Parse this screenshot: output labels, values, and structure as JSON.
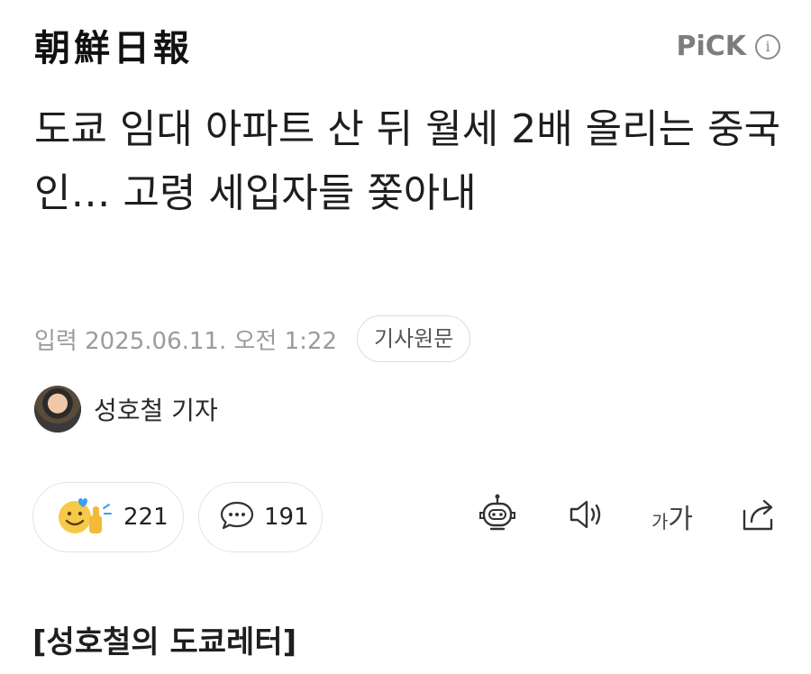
{
  "header": {
    "logo_text": "朝鮮日報",
    "pick_label": "PiCK",
    "info_glyph": "i"
  },
  "article": {
    "title": "도쿄 임대 아파트 산 뒤 월세 2배 올리는 중국인… 고령 세입자들 쫓아내",
    "date_label": "입력 2025.06.11. 오전 1:22",
    "source_button": "기사원문",
    "reporter_name": "성호철 기자",
    "section_label": "[성호철의 도쿄레터]"
  },
  "actions": {
    "reaction_count": "221",
    "comment_count": "191",
    "font_size_small": "가",
    "font_size_large": "가"
  },
  "icons": {
    "reaction": "smile-thumbs-icon",
    "comment": "speech-bubble-icon",
    "robot": "robot-summary-icon",
    "speaker": "speaker-icon",
    "font": "font-size-icon",
    "share": "share-icon"
  },
  "colors": {
    "text": "#1e1e1e",
    "muted": "#9b9b9b",
    "pick": "#7d7d7d",
    "border": "#e3e3e3",
    "reaction_yellow": "#f7c948",
    "reaction_heart": "#3ba0f0"
  }
}
